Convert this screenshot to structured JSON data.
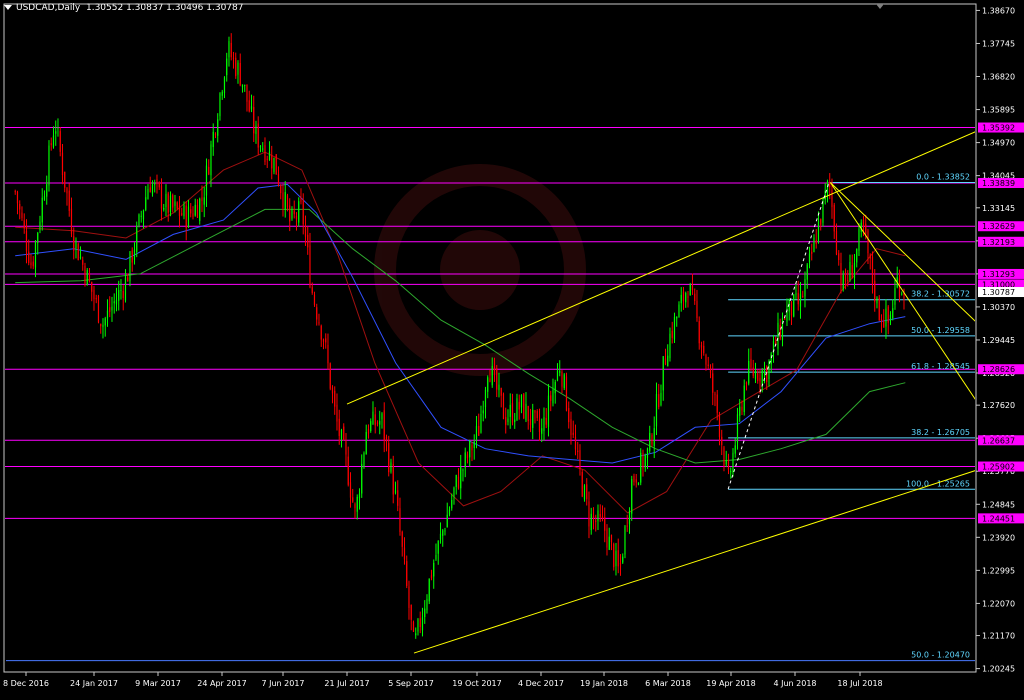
{
  "header": {
    "symbol": "USDCAD,Daily",
    "open": "1.30552",
    "high": "1.30837",
    "low": "1.30496",
    "close": "1.30787"
  },
  "colors": {
    "background": "#000000",
    "frame": "#c8c8c8",
    "level_line": "#ff00ff",
    "level_label_bg": "#ff00ff",
    "fib_line": "#5fd7ff",
    "fib_text": "#5fd7ff",
    "trendline": "#ffff00",
    "bull_candle": "#00ff00",
    "bear_candle": "#ff0000",
    "ma_blue": "#3050ff",
    "ma_green": "#2ea82e",
    "ma_red": "#a01010",
    "current_price_bg": "#ffffff"
  },
  "chart_data": {
    "type": "candlestick",
    "ylim": [
      1.2015,
      1.3885
    ],
    "y_ticks": [
      "1.38670",
      "1.37745",
      "1.36820",
      "1.35895",
      "1.34970",
      "1.34045",
      "1.33145",
      "1.32220",
      "1.31295",
      "1.30370",
      "1.29445",
      "1.28520",
      "1.27620",
      "1.26695",
      "1.25770",
      "1.24845",
      "1.23920",
      "1.22995",
      "1.22070",
      "1.21170",
      "1.20245"
    ],
    "x_ticks": [
      "8 Dec 2016",
      "24 Jan 2017",
      "9 Mar 2017",
      "24 Apr 2017",
      "7 Jun 2017",
      "21 Jul 2017",
      "5 Sep 2017",
      "19 Oct 2017",
      "4 Dec 2017",
      "19 Jan 2018",
      "6 Mar 2018",
      "19 Apr 2018",
      "4 Jun 2018",
      "18 Jul 2018"
    ],
    "horizontal_levels": [
      {
        "price": 1.35392,
        "label": "1.35392"
      },
      {
        "price": 1.33839,
        "label": "1.33839"
      },
      {
        "price": 1.32629,
        "label": "1.32629"
      },
      {
        "price": 1.32193,
        "label": "1.32193"
      },
      {
        "price": 1.31293,
        "label": "1.31293"
      },
      {
        "price": 1.31,
        "label": "1.31000"
      },
      {
        "price": 1.28626,
        "label": "1.28626"
      },
      {
        "price": 1.26637,
        "label": "1.26637"
      },
      {
        "price": 1.25902,
        "label": "1.25902"
      },
      {
        "price": 1.24451,
        "label": "1.24451"
      }
    ],
    "current_price": {
      "price": 1.30787,
      "label": "1.30787"
    },
    "fib_levels": [
      {
        "price": 1.33852,
        "label": "0.0 - 1.33852",
        "start": "2018-06-27"
      },
      {
        "price": 1.30572,
        "label": "38.2 - 1.30572",
        "start": "2018-04-17"
      },
      {
        "price": 1.29558,
        "label": "50.0 - 1.29558",
        "start": "2018-04-17"
      },
      {
        "price": 1.28545,
        "label": "61.8 - 1.28545",
        "start": "2018-04-17"
      },
      {
        "price": 1.26705,
        "label": "38.2 - 1.26705",
        "start": "2018-04-17"
      },
      {
        "price": 1.25265,
        "label": "100.0 - 1.25265",
        "start": "2018-04-17"
      },
      {
        "price": 1.2047,
        "label": "50.0 - 1.20470",
        "start": "2016-11-25"
      }
    ],
    "trendlines": [
      {
        "from": [
          "2017-07-21",
          1.2765
        ],
        "to": [
          "2018-10-31",
          1.3562
        ]
      },
      {
        "from": [
          "2017-09-07",
          1.2068
        ],
        "to": [
          "2018-10-31",
          1.2605
        ]
      },
      {
        "from": [
          "2018-06-28",
          1.3385
        ],
        "to": [
          "2018-10-31",
          1.292
        ]
      },
      {
        "from": [
          "2018-06-28",
          1.3385
        ],
        "to": [
          "2018-10-31",
          1.2658
        ]
      }
    ],
    "fib_dashed": {
      "from": [
        "2018-04-17",
        1.2527
      ],
      "to": [
        "2018-06-27",
        1.3385
      ]
    },
    "price_path": [
      [
        "2016-12-01",
        1.336
      ],
      [
        "2016-12-12",
        1.315
      ],
      [
        "2016-12-28",
        1.356
      ],
      [
        "2017-01-10",
        1.323
      ],
      [
        "2017-01-30",
        1.299
      ],
      [
        "2017-02-15",
        1.311
      ],
      [
        "2017-03-03",
        1.339
      ],
      [
        "2017-03-15",
        1.332
      ],
      [
        "2017-03-30",
        1.329
      ],
      [
        "2017-04-10",
        1.334
      ],
      [
        "2017-04-28",
        1.376
      ],
      [
        "2017-05-08",
        1.368
      ],
      [
        "2017-05-18",
        1.352
      ],
      [
        "2017-06-01",
        1.344
      ],
      [
        "2017-06-12",
        1.327
      ],
      [
        "2017-06-20",
        1.331
      ],
      [
        "2017-06-27",
        1.308
      ],
      [
        "2017-07-05",
        1.295
      ],
      [
        "2017-07-13",
        1.273
      ],
      [
        "2017-07-21",
        1.259
      ],
      [
        "2017-07-27",
        1.245
      ],
      [
        "2017-08-04",
        1.27
      ],
      [
        "2017-08-15",
        1.272
      ],
      [
        "2017-08-25",
        1.25
      ],
      [
        "2017-09-07",
        1.208
      ],
      [
        "2017-09-20",
        1.232
      ],
      [
        "2017-10-05",
        1.254
      ],
      [
        "2017-10-20",
        1.269
      ],
      [
        "2017-10-27",
        1.288
      ],
      [
        "2017-11-08",
        1.273
      ],
      [
        "2017-11-20",
        1.276
      ],
      [
        "2017-12-04",
        1.268
      ],
      [
        "2017-12-18",
        1.288
      ],
      [
        "2017-12-29",
        1.263
      ],
      [
        "2018-01-08",
        1.245
      ],
      [
        "2018-01-19",
        1.242
      ],
      [
        "2018-01-30",
        1.229
      ],
      [
        "2018-02-08",
        1.255
      ],
      [
        "2018-02-20",
        1.263
      ],
      [
        "2018-03-06",
        1.294
      ],
      [
        "2018-03-20",
        1.31
      ],
      [
        "2018-04-02",
        1.288
      ],
      [
        "2018-04-10",
        1.273
      ],
      [
        "2018-04-17",
        1.254
      ],
      [
        "2018-04-30",
        1.285
      ],
      [
        "2018-05-15",
        1.286
      ],
      [
        "2018-05-28",
        1.302
      ],
      [
        "2018-06-08",
        1.305
      ],
      [
        "2018-06-19",
        1.325
      ],
      [
        "2018-06-27",
        1.3385
      ],
      [
        "2018-07-06",
        1.309
      ],
      [
        "2018-07-13",
        1.315
      ],
      [
        "2018-07-20",
        1.326
      ],
      [
        "2018-07-31",
        1.303
      ],
      [
        "2018-08-08",
        1.299
      ],
      [
        "2018-08-14",
        1.311
      ],
      [
        "2018-08-20",
        1.3079
      ]
    ],
    "ma_blue": [
      [
        "2016-12-01",
        1.318
      ],
      [
        "2017-01-10",
        1.32
      ],
      [
        "2017-02-15",
        1.317
      ],
      [
        "2017-03-20",
        1.324
      ],
      [
        "2017-04-25",
        1.328
      ],
      [
        "2017-05-20",
        1.337
      ],
      [
        "2017-06-10",
        1.338
      ],
      [
        "2017-06-30",
        1.33
      ],
      [
        "2017-07-25",
        1.312
      ],
      [
        "2017-08-25",
        1.288
      ],
      [
        "2017-09-25",
        1.27
      ],
      [
        "2017-10-25",
        1.264
      ],
      [
        "2017-11-25",
        1.262
      ],
      [
        "2017-12-25",
        1.261
      ],
      [
        "2018-01-25",
        1.26
      ],
      [
        "2018-02-25",
        1.263
      ],
      [
        "2018-03-25",
        1.27
      ],
      [
        "2018-04-25",
        1.271
      ],
      [
        "2018-05-25",
        1.28
      ],
      [
        "2018-06-25",
        1.295
      ],
      [
        "2018-07-25",
        1.299
      ],
      [
        "2018-08-20",
        1.301
      ]
    ],
    "ma_green": [
      [
        "2016-12-01",
        1.3105
      ],
      [
        "2017-01-15",
        1.311
      ],
      [
        "2017-02-25",
        1.313
      ],
      [
        "2017-04-10",
        1.322
      ],
      [
        "2017-05-25",
        1.331
      ],
      [
        "2017-06-25",
        1.331
      ],
      [
        "2017-07-25",
        1.32
      ],
      [
        "2017-08-25",
        1.311
      ],
      [
        "2017-09-25",
        1.3
      ],
      [
        "2017-10-25",
        1.293
      ],
      [
        "2017-11-25",
        1.285
      ],
      [
        "2017-12-25",
        1.278
      ],
      [
        "2018-01-25",
        1.27
      ],
      [
        "2018-02-25",
        1.264
      ],
      [
        "2018-03-25",
        1.26
      ],
      [
        "2018-04-25",
        1.261
      ],
      [
        "2018-05-25",
        1.264
      ],
      [
        "2018-06-25",
        1.268
      ],
      [
        "2018-07-25",
        1.28
      ],
      [
        "2018-08-20",
        1.2825
      ]
    ],
    "ma_red": [
      [
        "2016-12-01",
        1.326
      ],
      [
        "2017-01-10",
        1.325
      ],
      [
        "2017-02-15",
        1.323
      ],
      [
        "2017-03-20",
        1.33
      ],
      [
        "2017-04-25",
        1.342
      ],
      [
        "2017-05-25",
        1.347
      ],
      [
        "2017-06-20",
        1.342
      ],
      [
        "2017-07-15",
        1.318
      ],
      [
        "2017-08-10",
        1.288
      ],
      [
        "2017-09-10",
        1.26
      ],
      [
        "2017-10-10",
        1.248
      ],
      [
        "2017-11-05",
        1.252
      ],
      [
        "2017-12-05",
        1.262
      ],
      [
        "2018-01-05",
        1.258
      ],
      [
        "2018-02-05",
        1.246
      ],
      [
        "2018-03-05",
        1.252
      ],
      [
        "2018-04-05",
        1.272
      ],
      [
        "2018-05-05",
        1.279
      ],
      [
        "2018-06-05",
        1.286
      ],
      [
        "2018-07-05",
        1.308
      ],
      [
        "2018-07-30",
        1.32
      ],
      [
        "2018-08-20",
        1.318
      ]
    ]
  }
}
